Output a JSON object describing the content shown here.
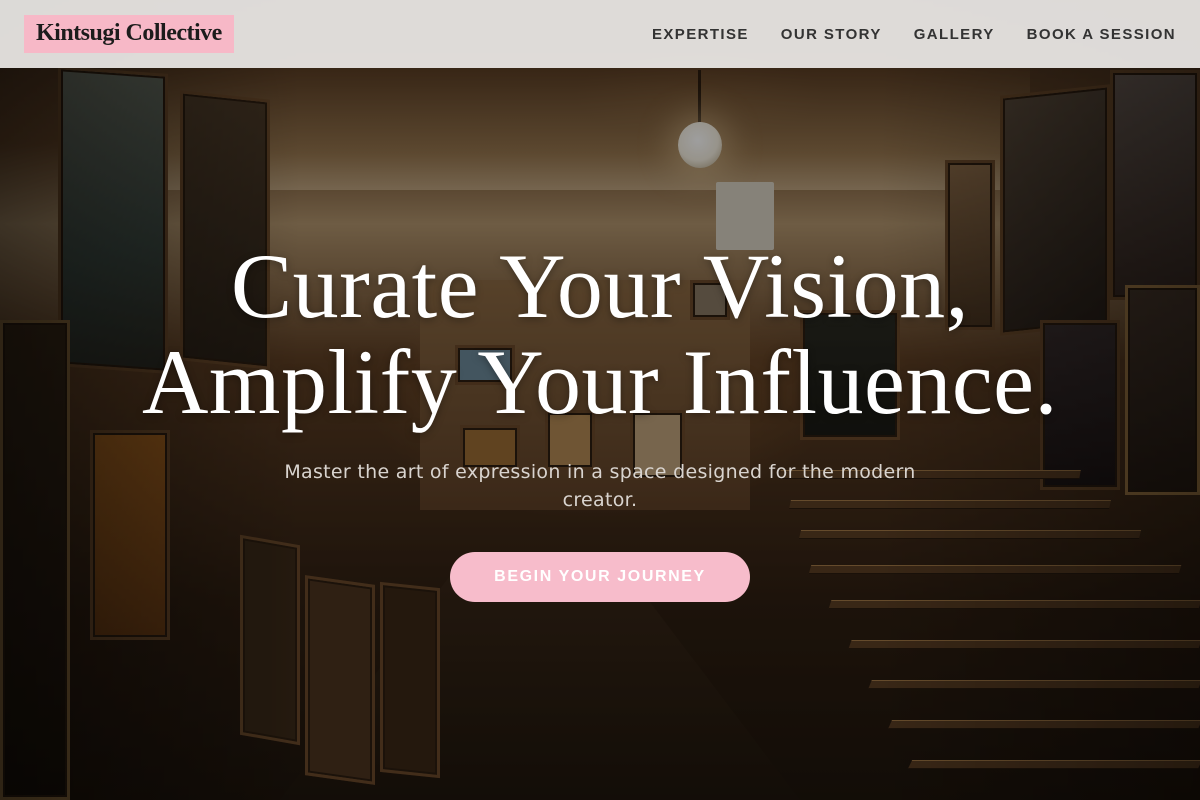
{
  "brand": {
    "name": "Kintsugi Collective",
    "badge_color": "#f7b8c7"
  },
  "nav": {
    "items": [
      {
        "label": "EXPERTISE"
      },
      {
        "label": "OUR STORY"
      },
      {
        "label": "GALLERY"
      },
      {
        "label": "BOOK A SESSION"
      }
    ]
  },
  "hero": {
    "headline_line1": "Curate Your Vision,",
    "headline_line2": "Amplify Your Influence.",
    "subtitle": "Master the art of expression in a space designed for the modern creator.",
    "cta_label": "BEGIN YOUR JOURNEY",
    "cta_color": "#f7bccb",
    "background_image": "art-storeroom-photo"
  }
}
